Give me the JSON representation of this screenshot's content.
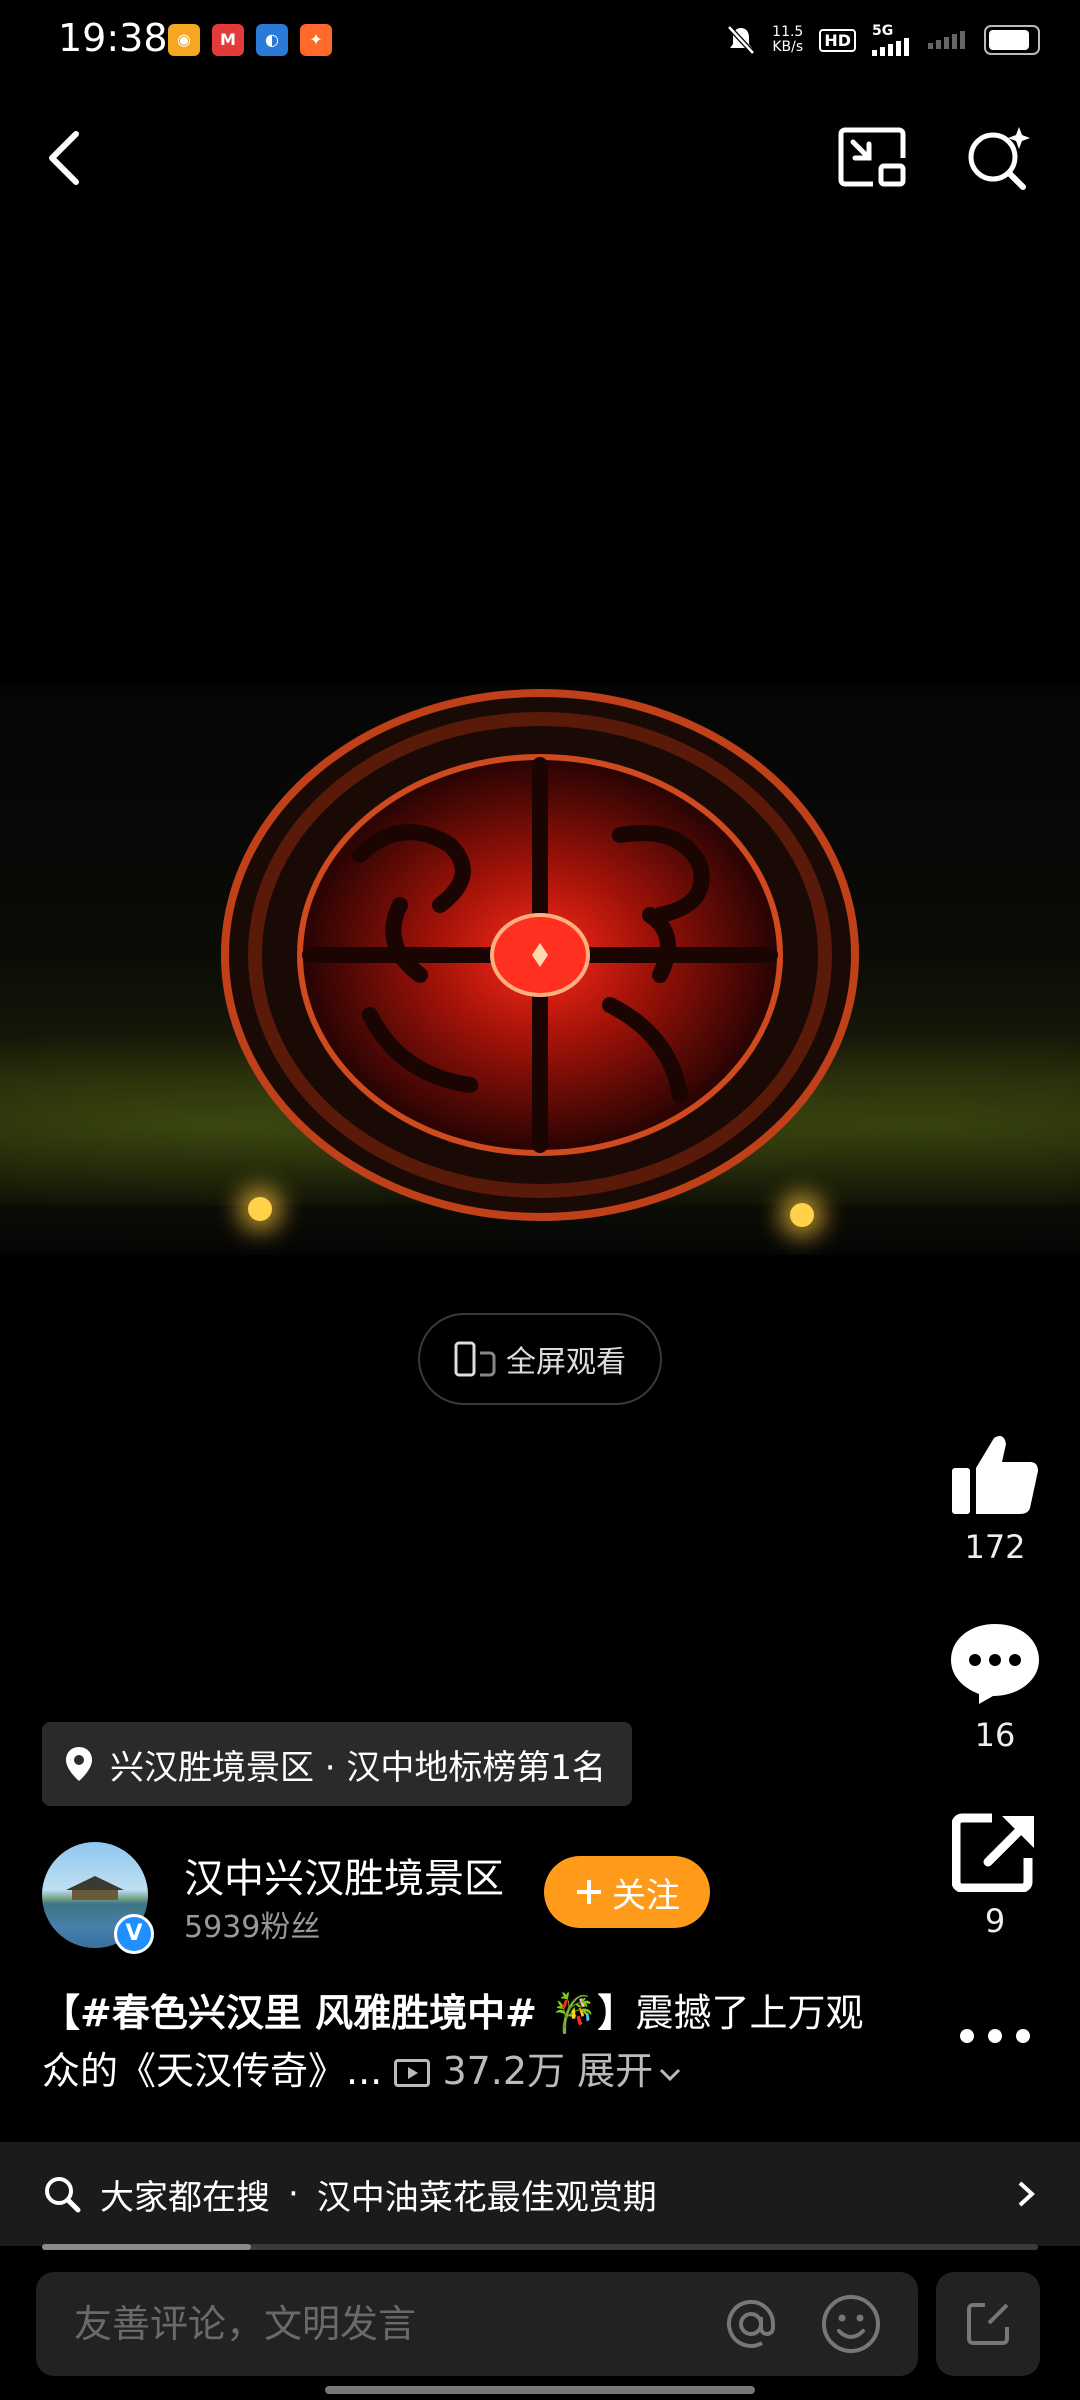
{
  "status_bar": {
    "time": "19:38",
    "net_speed_value": "11.5",
    "net_speed_unit": "KB/s",
    "hd": "HD",
    "network": "5G",
    "notification_apps": [
      "weibo-icon",
      "app-icon-red",
      "app-icon-blue",
      "app-icon-orange"
    ]
  },
  "top_bar": {
    "back_icon": "chevron-left-icon",
    "pip_icon": "picture-in-picture-icon",
    "search_icon": "search-sparkle-icon"
  },
  "player": {
    "fullscreen_label": "全屏观看"
  },
  "actions": {
    "likes": "172",
    "comments": "16",
    "shares": "9"
  },
  "location": {
    "text": "兴汉胜境景区 · 汉中地标榜第1名"
  },
  "author": {
    "name": "汉中兴汉胜境景区",
    "fans": "5939粉丝",
    "follow_label": "关注"
  },
  "caption": {
    "hashtag": "【#春色兴汉里 风雅胜境中# 🎋】",
    "text": "震撼了上万观众的《天汉传奇》...",
    "views": "37.2万",
    "expand": "展开"
  },
  "search_bar": {
    "prefix": "大家都在搜",
    "separator": "·",
    "query": "汉中油菜花最佳观赏期"
  },
  "progress": 0.21,
  "comment_box": {
    "placeholder": "友善评论，文明发言"
  },
  "colors": {
    "accent": "#ff9a1a",
    "verified": "#1e90ff",
    "background": "#000000"
  }
}
